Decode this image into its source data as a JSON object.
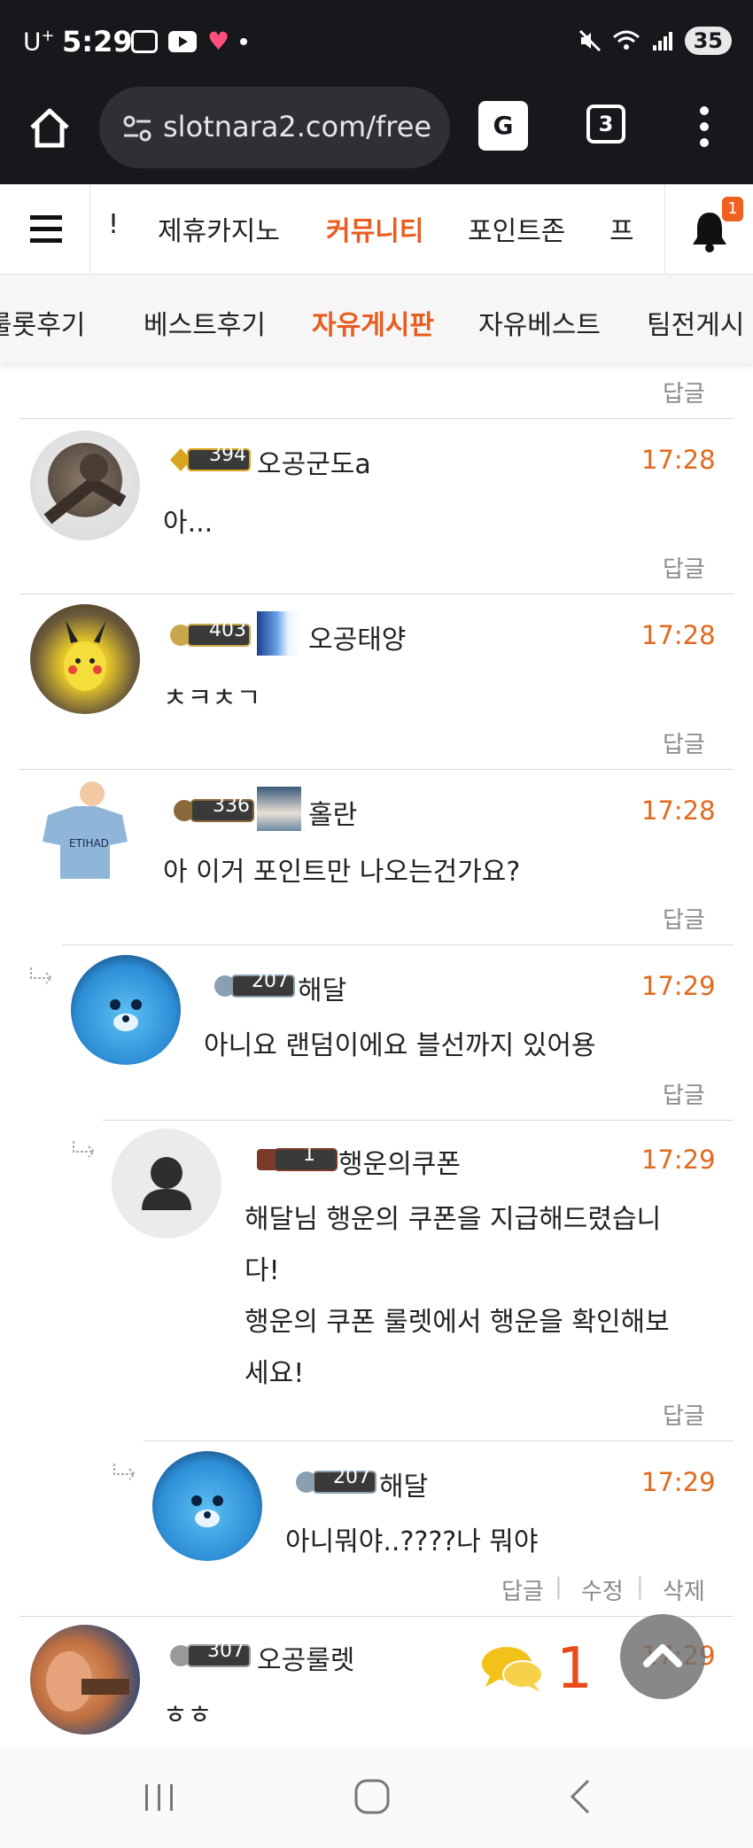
{
  "status_bar": {
    "carrier": "U",
    "carrier_sup": "+",
    "time": "5:29",
    "battery": "35",
    "icons": [
      "screenshot-icon",
      "youtube-icon",
      "heart-icon",
      "dot-icon",
      "mute-icon",
      "wifi-icon",
      "signal-icon",
      "battery-icon"
    ]
  },
  "browser": {
    "url": "slotnara2.com/free",
    "tab_count": "3",
    "translate_label": "G"
  },
  "site_nav": {
    "items": [
      {
        "label": "!"
      },
      {
        "label": "제휴카지노"
      },
      {
        "label": "커뮤니티"
      },
      {
        "label": "포인트존"
      },
      {
        "label": "프"
      }
    ],
    "notification_count": "1"
  },
  "sub_nav": {
    "items": [
      {
        "label": "룰롯후기"
      },
      {
        "label": "베스트후기"
      },
      {
        "label": "자유게시판"
      },
      {
        "label": "자유베스트"
      },
      {
        "label": "팀전게시"
      }
    ]
  },
  "labels": {
    "reply": "답글",
    "edit": "수정",
    "delete": "삭제",
    "separator": "|"
  },
  "comments": [
    {
      "level": "394",
      "author": "오공군도a",
      "time": "17:28",
      "lines": [
        "아..."
      ]
    },
    {
      "level": "403",
      "author": "오공태양",
      "time": "17:28",
      "lines": [
        "ㅊㅋㅊㄱ"
      ]
    },
    {
      "level": "336",
      "author": "홀란",
      "time": "17:28",
      "lines": [
        "아 이거 포인트만 나오는건가요?"
      ]
    },
    {
      "level": "207",
      "author": "해달",
      "time": "17:29",
      "lines": [
        "아니요 랜덤이에요 블선까지 있어용"
      ]
    },
    {
      "level": "1",
      "author": "행운의쿠폰",
      "time": "17:29",
      "lines": [
        "해달님 행운의 쿠폰을 지급해드렸습니",
        "다!",
        "행운의 쿠폰 룰렛에서 행운을 확인해보",
        "세요!"
      ]
    },
    {
      "level": "207",
      "author": "해달",
      "time": "17:29",
      "lines": [
        "아니뭐야..????나 뭐야"
      ]
    },
    {
      "level": "307",
      "author": "오공룰렛",
      "time": "17:29",
      "lines": [
        "ㅎㅎ"
      ]
    }
  ],
  "floating": {
    "chat_count": "1"
  },
  "colors": {
    "accent": "#e85d1f",
    "time": "#e06a1f",
    "status_bg": "#17181c"
  }
}
